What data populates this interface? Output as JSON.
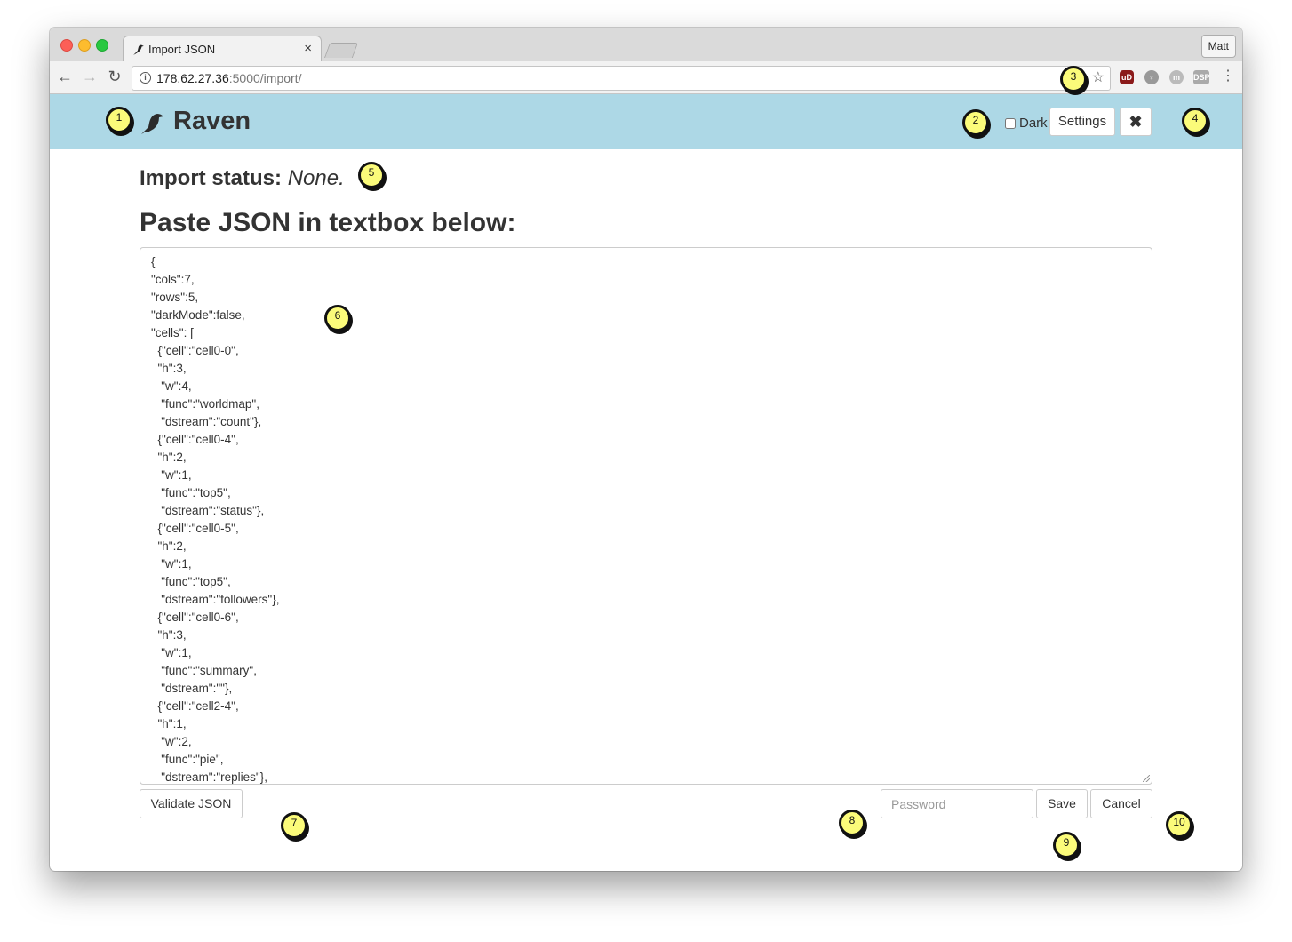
{
  "browser": {
    "tab_title": "Import JSON",
    "tab_close": "×",
    "profile_name": "Matt",
    "url_host": "178.62.27.36",
    "url_rest": ":5000/import/",
    "info_glyph": "i",
    "star_glyph": "☆",
    "back_glyph": "←",
    "forward_glyph": "→",
    "reload_glyph": "↻",
    "menu_glyph": "⋮",
    "extensions": {
      "ublock": "uD",
      "bulb": "♀",
      "m": "m",
      "dsp": "DSP"
    },
    "icons": [
      "back-arrow-icon",
      "forward-arrow-icon",
      "reload-icon",
      "info-icon",
      "star-icon",
      "ublock-icon",
      "bulb-icon",
      "m-icon",
      "dsp-icon",
      "menu-dots-icon"
    ]
  },
  "header": {
    "brand": "Raven",
    "dark_label": "Dark",
    "dark_checked": false,
    "settings_label": "Settings",
    "close_label": "✖",
    "background": "#add8e6"
  },
  "main": {
    "status_label": "Import status:",
    "status_value": "None.",
    "heading": "Paste JSON in textbox below:",
    "json_lines": [
      "{",
      "\"cols\":7,",
      "\"rows\":5,",
      "\"darkMode\":false,",
      "\"cells\": [",
      "  {\"cell\":\"cell0-0\",",
      "  \"h\":3,",
      "   \"w\":4,",
      "   \"func\":\"worldmap\",",
      "   \"dstream\":\"count\"},",
      "  {\"cell\":\"cell0-4\",",
      "  \"h\":2,",
      "   \"w\":1,",
      "   \"func\":\"top5\",",
      "   \"dstream\":\"status\"},",
      "  {\"cell\":\"cell0-5\",",
      "  \"h\":2,",
      "   \"w\":1,",
      "   \"func\":\"top5\",",
      "   \"dstream\":\"followers\"},",
      "  {\"cell\":\"cell0-6\",",
      "  \"h\":3,",
      "   \"w\":1,",
      "   \"func\":\"summary\",",
      "   \"dstream\":\"\"},",
      "  {\"cell\":\"cell2-4\",",
      "  \"h\":1,",
      "   \"w\":2,",
      "   \"func\":\"pie\",",
      "   \"dstream\":\"replies\"},"
    ],
    "validate_label": "Validate JSON",
    "password_placeholder": "Password",
    "password_value": "",
    "save_label": "Save",
    "cancel_label": "Cancel"
  },
  "markers": [
    "1",
    "2",
    "3",
    "4",
    "5",
    "6",
    "7",
    "8",
    "9",
    "10"
  ],
  "marker_color": "#fbfb7a"
}
